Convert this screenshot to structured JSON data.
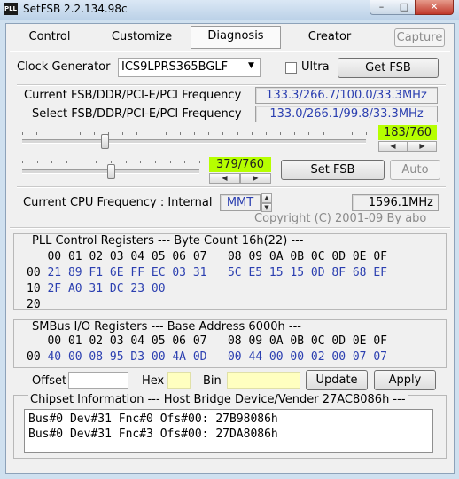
{
  "window": {
    "title": "SetFSB 2.2.134.98c"
  },
  "tabs": [
    {
      "label": "Control"
    },
    {
      "label": "Customize"
    },
    {
      "label": "Diagnosis"
    },
    {
      "label": "Creator"
    }
  ],
  "capture_label": "Capture",
  "clock": {
    "label": "Clock Generator",
    "value": "ICS9LPRS365BGLF",
    "ultra_label": "Ultra",
    "ultra_checked": false,
    "get_fsb_label": "Get FSB"
  },
  "freq": {
    "current_label": "Current FSB/DDR/PCI-E/PCI Frequency",
    "current_value": "133.3/266.7/100.0/33.3MHz",
    "select_label": "Select FSB/DDR/PCI-E/PCI Frequency",
    "select_value": "133.0/266.1/99.8/33.3MHz"
  },
  "slider1": {
    "display": "183/760",
    "level": 0.2408
  },
  "slider2": {
    "display": "379/760",
    "level": 0.4987
  },
  "set_fsb_label": "Set FSB",
  "auto_label": "Auto",
  "cpu": {
    "label": "Current CPU Frequency : Internal",
    "source": "MMT",
    "value": "1596.1MHz"
  },
  "copyright": "Copyright (C) 2001-09 By abo",
  "pll": {
    "title": "PLL Control Registers  --- Byte Count 16h(22) ---",
    "header": "   00 01 02 03 04 05 06 07   08 09 0A 0B 0C 0D 0E 0F",
    "rows": [
      {
        "addr": "00",
        "left": "21 89 F1 6E FF EC 03 31",
        "right": "5C E5 15 15 0D 8F 68 EF"
      },
      {
        "addr": "10",
        "left": "2F A0 31 DC 23 00",
        "right": ""
      },
      {
        "addr": "20",
        "left": "",
        "right": ""
      }
    ]
  },
  "smbus": {
    "title": "SMBus I/O Registers  --- Base Address 6000h ---",
    "header": "   00 01 02 03 04 05 06 07   08 09 0A 0B 0C 0D 0E 0F",
    "rows": [
      {
        "addr": "00",
        "left": "40 00 08 95 D3 00 4A 0D",
        "right": "00 44 00 00 02 00 07 07"
      }
    ]
  },
  "editor": {
    "offset_label": "Offset",
    "hex_label": "Hex",
    "bin_label": "Bin",
    "update_label": "Update",
    "apply_label": "Apply"
  },
  "chipset": {
    "title": "Chipset Information  --- Host Bridge Device/Vender 27AC8086h ---",
    "lines": [
      "Bus#0 Dev#31 Fnc#0 Ofs#00: 27B98086h",
      "Bus#0 Dev#31 Fnc#3 Ofs#00: 27DA8086h"
    ]
  },
  "colors": {
    "value_text": "#2b3fb0",
    "display_green": "#b6ff00",
    "chrome_blue": "#cfe0ef"
  },
  "icons": {
    "app": "pll-icon",
    "minimize": "minimize-icon",
    "maximize": "maximize-icon",
    "close": "close-icon"
  }
}
